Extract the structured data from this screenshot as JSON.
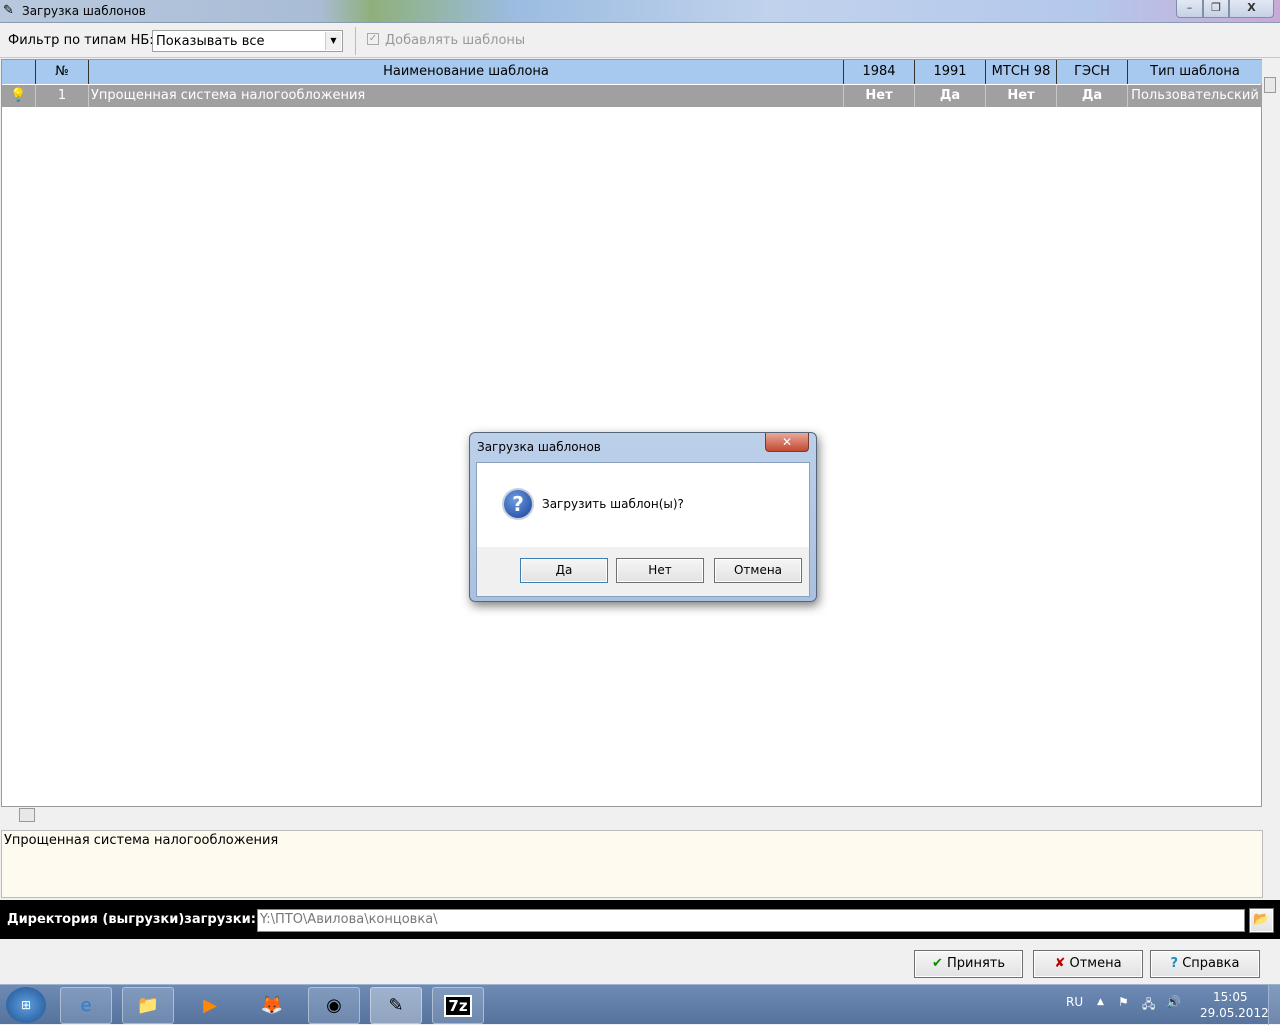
{
  "window": {
    "title": "Загрузка шаблонов",
    "minimize": "–",
    "restore": "❐",
    "close": "X"
  },
  "toolbar": {
    "filter_label": "Фильтр по типам НБ:",
    "filter_value": "Показывать все",
    "add_templates_label": "Добавлять шаблоны",
    "add_templates_checked": true
  },
  "grid": {
    "columns": [
      "",
      "№",
      "Наименование шаблона",
      "1984",
      "1991",
      "МТСН 98",
      "ГЭСН",
      "Тип шаблона"
    ],
    "rows": [
      {
        "icon": "lightbulb-icon",
        "num": "1",
        "name": "Упрощенная система налогообложения",
        "y1984": "Нет",
        "y1991": "Да",
        "mtsn98": "Нет",
        "gesn": "Да",
        "type": "Пользовательский"
      }
    ]
  },
  "memo": {
    "text": "Упрощенная система налогообложения"
  },
  "directory": {
    "label": "Директория (выгрузки)загрузки:",
    "value": "Y:\\ПТО\\Авилова\\концовка\\"
  },
  "buttons": {
    "accept": "Принять",
    "cancel": "Отмена",
    "help": "Справка"
  },
  "dialog": {
    "title": "Загрузка шаблонов",
    "message": "Загрузить шаблон(ы)?",
    "yes": "Да",
    "no": "Нет",
    "cancel": "Отмена",
    "close": "✕"
  },
  "taskbar": {
    "lang": "RU",
    "time": "15:05",
    "date": "29.05.2012",
    "apps": [
      "internet-explorer",
      "explorer",
      "media-player",
      "firefox",
      "chrome",
      "template-editor",
      "7zip"
    ]
  }
}
